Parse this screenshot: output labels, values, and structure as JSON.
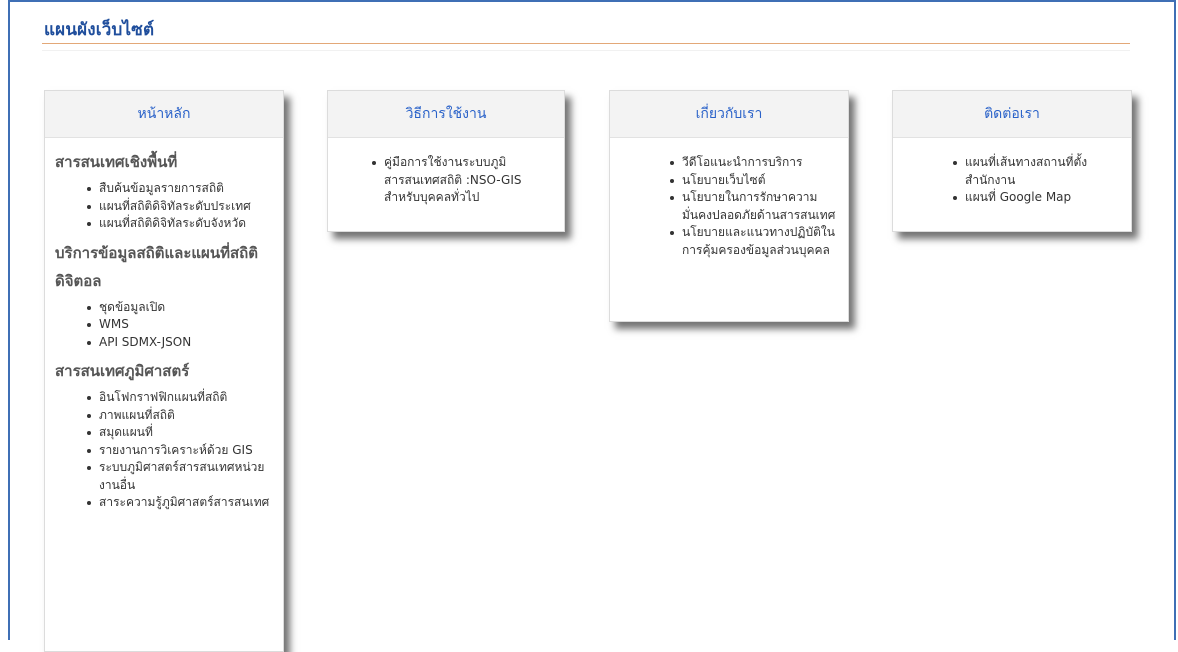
{
  "page": {
    "title": "แผนผังเว็บไซต์"
  },
  "columns": [
    {
      "header": "หน้าหลัก",
      "sections": [
        {
          "title": "สารสนเทศเชิงพื้นที่",
          "items": [
            "สืบค้นข้อมูลรายการสถิติ",
            "แผนที่สถิติดิจิทัลระดับประเทศ",
            "แผนที่สถิติดิจิทัลระดับจังหวัด"
          ]
        },
        {
          "title": "บริการข้อมูลสถิติและแผนที่สถิติดิจิตอล",
          "items": [
            "ชุดข้อมูลเปิด",
            "WMS",
            "API SDMX-JSON"
          ]
        },
        {
          "title": "สารสนเทศภูมิศาสตร์",
          "items": [
            "อินโฟกราฟฟิกแผนที่สถิติ",
            "ภาพแผนที่สถิติ",
            "สมุดแผนที่",
            "รายงานการวิเคราะห์ด้วย GIS",
            "ระบบภูมิศาสตร์สารสนเทศหน่วยงานอื่น",
            "สาระความรู้ภูมิศาสตร์สารสนเทศ"
          ]
        }
      ]
    },
    {
      "header": "วิธีการใช้งาน",
      "items": [
        "คู่มือการใช้งานระบบภูมิสารสนเทศสถิติ :NSO-GIS สำหรับบุคคลทั่วไป"
      ]
    },
    {
      "header": "เกี่ยวกับเรา",
      "items": [
        "วีดีโอแนะนำการบริการ",
        "นโยบายเว็บไซต์",
        "นโยบายในการรักษาความมั่นคงปลอดภัยด้านสารสนเทศ",
        "นโยบายและแนวทางปฏิบัติในการคุ้มครองข้อมูลส่วนบุคคล"
      ]
    },
    {
      "header": "ติดต่อเรา",
      "items": [
        "แผนที่เส้นทางสถานที่ตั้งสำนักงาน",
        "แผนที่ Google Map"
      ]
    }
  ],
  "colors": {
    "title": "#1f4e9c",
    "header_text": "#2a62c9",
    "rule": "#e3a878",
    "frame": "#3f6fb5"
  }
}
